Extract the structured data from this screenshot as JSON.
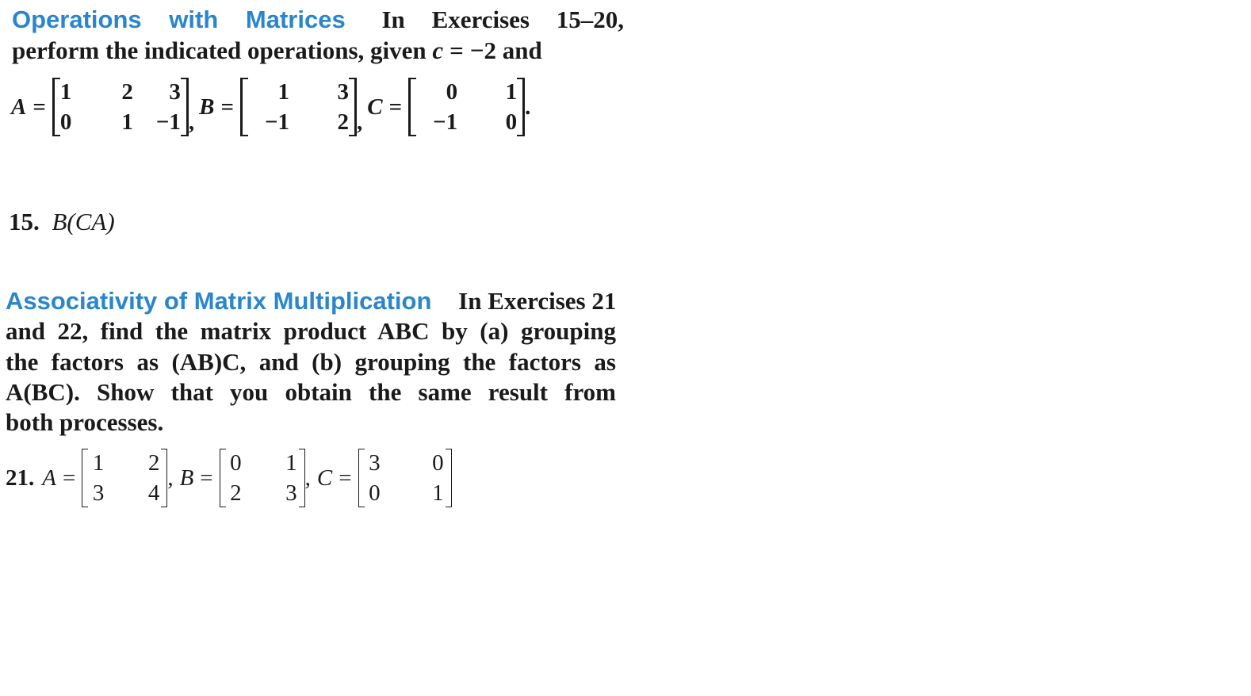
{
  "section1": {
    "heading": "Operations with Matrices",
    "intro_line1": "In Exercises 15–20,",
    "intro_line2_pre": "perform the indicated operations, given ",
    "scalar_var": "c",
    "equals": "=",
    "scalar_value": "−2",
    "intro_line2_post": " and",
    "matrices": [
      {
        "name": "A",
        "rows": [
          [
            "1",
            "2",
            "3"
          ],
          [
            "0",
            "1",
            "−1"
          ]
        ],
        "trail": ","
      },
      {
        "name": "B",
        "rows": [
          [
            "1",
            "3"
          ],
          [
            "−1",
            "2"
          ]
        ],
        "trail": ","
      },
      {
        "name": "C",
        "rows": [
          [
            "0",
            "1"
          ],
          [
            "−1",
            "0"
          ]
        ],
        "trail": "."
      }
    ]
  },
  "exercise15": {
    "number": "15.",
    "expression": "B(CA)"
  },
  "section2": {
    "heading": "Associativity of Matrix Multiplication",
    "lines": [
      "In Exercises 21",
      "and 22, find the matrix product ABC by (a) grouping",
      "the factors as (AB)C, and (b) grouping the factors as",
      "A(BC). Show that you obtain the same result from",
      "both processes."
    ]
  },
  "exercise21": {
    "number": "21.",
    "equals": "=",
    "matrices": [
      {
        "name": "A",
        "rows": [
          [
            "1",
            "2"
          ],
          [
            "3",
            "4"
          ]
        ],
        "trail": ","
      },
      {
        "name": "B",
        "rows": [
          [
            "0",
            "1"
          ],
          [
            "2",
            "3"
          ]
        ],
        "trail": ","
      },
      {
        "name": "C",
        "rows": [
          [
            "3",
            "0"
          ],
          [
            "0",
            "1"
          ]
        ],
        "trail": ""
      }
    ]
  }
}
